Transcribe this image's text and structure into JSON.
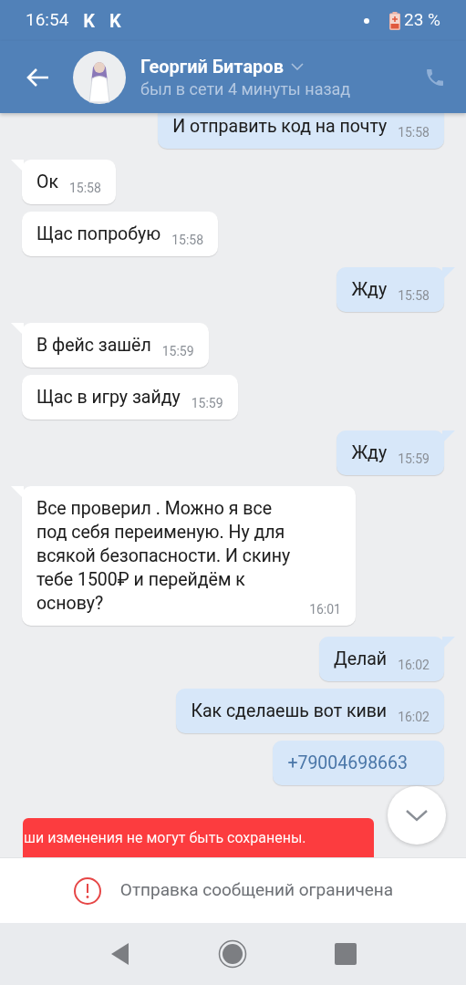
{
  "status_bar": {
    "time": "16:54",
    "notifications": [
      "K",
      "K"
    ],
    "battery": "23 %"
  },
  "header": {
    "name": "Георгий Битаров",
    "status": "был в сети 4 минуты назад"
  },
  "messages": [
    {
      "outgoing": true,
      "tail": false,
      "kind": "text",
      "text": "И отправить код на почту",
      "time": "15:58"
    },
    {
      "outgoing": false,
      "tail": true,
      "kind": "text",
      "text": "Ок",
      "time": "15:58"
    },
    {
      "outgoing": false,
      "tail": false,
      "kind": "text",
      "text": "Щас попробую",
      "time": "15:58"
    },
    {
      "outgoing": true,
      "tail": true,
      "kind": "text",
      "text": "Жду",
      "time": "15:58"
    },
    {
      "outgoing": false,
      "tail": true,
      "kind": "text",
      "text": "В фейс зашёл",
      "time": "15:59"
    },
    {
      "outgoing": false,
      "tail": false,
      "kind": "text",
      "text": "Щас в игру зайду",
      "time": "15:59"
    },
    {
      "outgoing": true,
      "tail": true,
      "kind": "text",
      "text": "Жду",
      "time": "15:59"
    },
    {
      "outgoing": false,
      "tail": true,
      "kind": "text",
      "text": "Все проверил . Можно я все под себя переименую. Ну для всякой безопасности. И скину тебе 1500₽ и перейдём к основу?",
      "time": "16:01"
    },
    {
      "outgoing": true,
      "tail": true,
      "kind": "text",
      "text": "Делай",
      "time": "16:02"
    },
    {
      "outgoing": true,
      "tail": false,
      "kind": "text",
      "text": "Как сделаешь вот киви",
      "time": "16:02"
    },
    {
      "outgoing": true,
      "tail": false,
      "kind": "link",
      "text": "+79004698663"
    }
  ],
  "toast": "ши изменения не могут быть сохранены.",
  "restriction": "Отправка сообщений ограничена"
}
